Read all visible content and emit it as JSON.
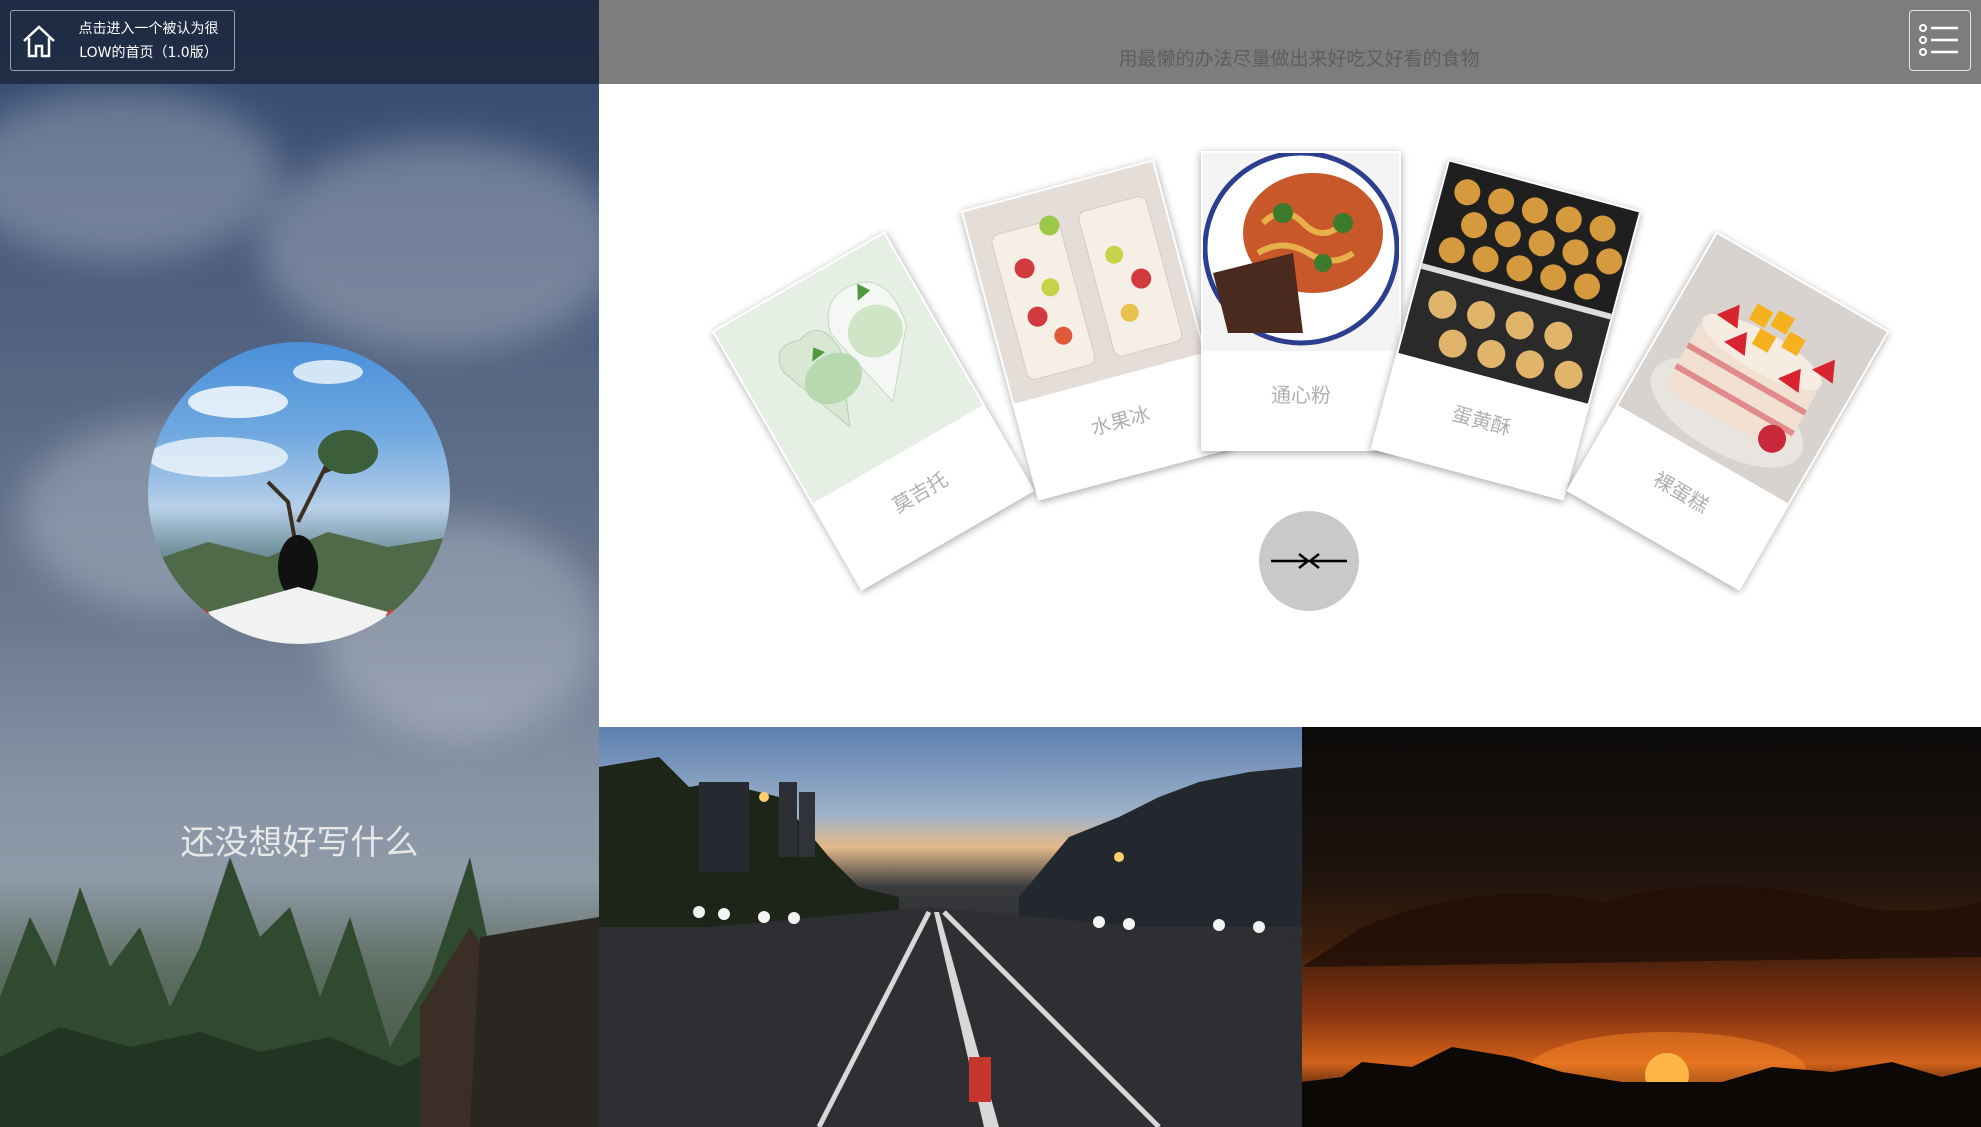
{
  "home": {
    "label_line1": "点击进入一个被认为很",
    "label_line2": "LOW的首页（1.0版）"
  },
  "header": {
    "subtitle": "用最懒的办法尽量做出来好吃又好看的食物"
  },
  "profile": {
    "tagline": "还没想好写什么"
  },
  "foods": [
    {
      "label": "莫吉托",
      "color": "#d9e8d6"
    },
    {
      "label": "水果冰",
      "color": "#e9d3cf"
    },
    {
      "label": "通心粉",
      "color": "#c65a2e"
    },
    {
      "label": "蛋黄酥",
      "color": "#c58a3a"
    },
    {
      "label": "裸蛋糕",
      "color": "#f2c4be"
    }
  ],
  "colors": {
    "top_bar": "#7d7d7d",
    "collapse_button": "#c9c9c9"
  },
  "icons": {
    "home": "home-icon",
    "menu": "list-menu-icon",
    "collapse": "arrows-collapse-icon"
  }
}
